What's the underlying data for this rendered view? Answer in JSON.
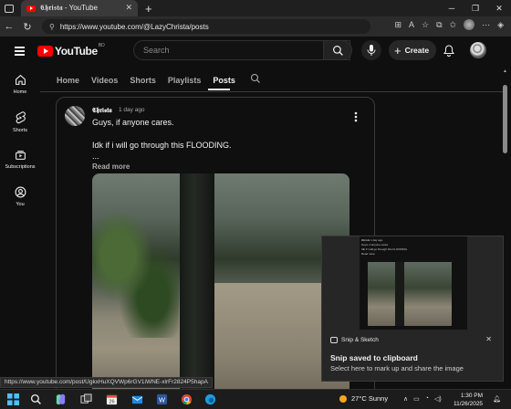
{
  "browser": {
    "tab_title": "𝕮𝖍𝖗𝖎𝖘𝖙𝖆 - YouTube",
    "url": "https://www.youtube.com/@LazyChrista/posts",
    "status_url": "https://www.youtube.com/post/UgkxHuXQVWp6rGV1iWNE-xlrFr2824P5hapA"
  },
  "header": {
    "logo_text": "YouTube",
    "region": "BD",
    "search_placeholder": "Search",
    "create_label": "Create"
  },
  "rail": [
    {
      "label": "Home",
      "icon": "home-icon"
    },
    {
      "label": "Shorts",
      "icon": "shorts-icon"
    },
    {
      "label": "Subscriptions",
      "icon": "subscriptions-icon"
    },
    {
      "label": "You",
      "icon": "you-icon"
    }
  ],
  "channel_tabs": [
    "Home",
    "Videos",
    "Shorts",
    "Playlists",
    "Posts"
  ],
  "active_tab": "Posts",
  "post": {
    "author": "𝕮𝖍𝖗𝖎𝖘𝖙𝖆",
    "time": "1 day ago",
    "lines": [
      "Guys, if anyone cares.",
      "Idk if i will go through this FLOODING.",
      "..."
    ],
    "read_more": "Read more"
  },
  "snip": {
    "app": "Snip & Sketch",
    "title": "Snip saved to clipboard",
    "subtitle": "Select here to mark up and share the image",
    "preview_text": [
      "𝕮𝖍𝖗𝖎𝖘𝖙𝖆 1 day ago",
      "Guys, if anyone cares.",
      "Idk if i will go through this FLOODING.",
      "Read more"
    ]
  },
  "taskbar": {
    "weather": "27°C  Sunny",
    "time": "1:30 PM",
    "date": "11/26/2025"
  }
}
